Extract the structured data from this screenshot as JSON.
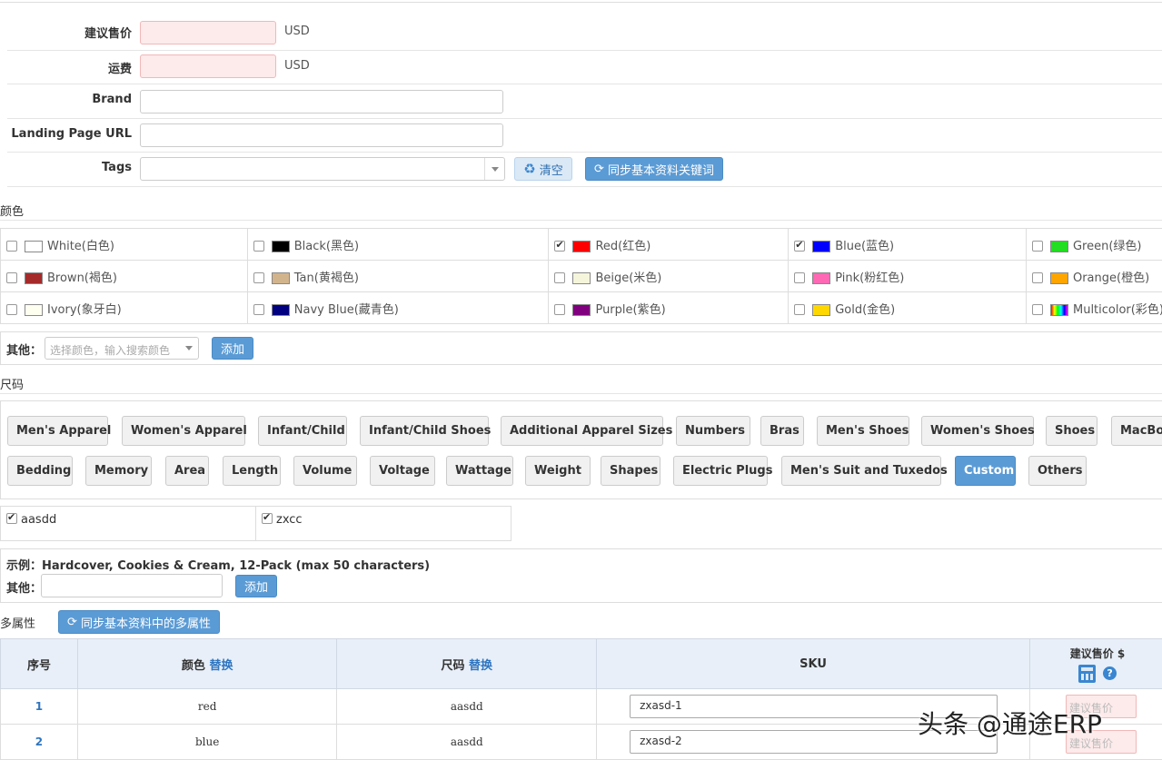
{
  "form": {
    "price_label": "建议售价",
    "price_unit": "USD",
    "shipping_label": "运费",
    "shipping_unit": "USD",
    "brand_label": "Brand",
    "landing_label": "Landing Page URL",
    "tags_label": "Tags",
    "clear_button": "清空",
    "sync_keywords_button": "同步基本资料关键词"
  },
  "colors": {
    "title": "颜色",
    "rows": [
      [
        {
          "label": "White(白色)",
          "hex": "#ffffff",
          "checked": false
        },
        {
          "label": "Black(黑色)",
          "hex": "#000000",
          "checked": false
        },
        {
          "label": "Red(红色)",
          "hex": "#ff0000",
          "checked": true
        },
        {
          "label": "Blue(蓝色)",
          "hex": "#0000ff",
          "checked": true
        },
        {
          "label": "Green(绿色)",
          "hex": "#22dd22",
          "checked": false
        }
      ],
      [
        {
          "label": "Brown(褐色)",
          "hex": "#a52a2a",
          "checked": false
        },
        {
          "label": "Tan(黄褐色)",
          "hex": "#d2b48c",
          "checked": false
        },
        {
          "label": "Beige(米色)",
          "hex": "#f5f5dc",
          "checked": false
        },
        {
          "label": "Pink(粉红色)",
          "hex": "#ff69b4",
          "checked": false
        },
        {
          "label": "Orange(橙色)",
          "hex": "#ffa500",
          "checked": false
        }
      ],
      [
        {
          "label": "Ivory(象牙白)",
          "hex": "#fffff0",
          "checked": false
        },
        {
          "label": "Navy Blue(藏青色)",
          "hex": "#000080",
          "checked": false
        },
        {
          "label": "Purple(紫色)",
          "hex": "#800080",
          "checked": false
        },
        {
          "label": "Gold(金色)",
          "hex": "#ffd700",
          "checked": false
        },
        {
          "label": "Multicolor(彩色)",
          "hex": "rainbow",
          "checked": false
        }
      ]
    ],
    "other_label": "其他：",
    "other_placeholder": "选择颜色，输入搜索颜色",
    "add_button": "添加"
  },
  "sizes": {
    "title": "尺码",
    "row1": [
      "Men's Apparel",
      "Women's Apparel",
      "Infant/Child",
      "Infant/Child Shoes",
      "Additional Apparel Sizes",
      "Numbers",
      "Bras",
      "Men's Shoes",
      "Women's Shoes",
      "Shoes",
      "MacBo"
    ],
    "row2": [
      "Bedding",
      "Memory",
      "Area",
      "Length",
      "Volume",
      "Voltage",
      "Wattage",
      "Weight",
      "Shapes",
      "Electric Plugs",
      "Men's Suit and Tuxedos",
      "Custom",
      "Others"
    ],
    "active": "Custom",
    "custom_items": [
      {
        "label": "aasdd",
        "checked": true
      },
      {
        "label": "zxcc",
        "checked": true
      }
    ],
    "example_text": "示例：Hardcover, Cookies & Cream, 12-Pack (max 50 characters)",
    "other_label": "其他：",
    "add_button": "添加"
  },
  "multi": {
    "title": "多属性",
    "sync_button": "同步基本资料中的多属性",
    "headers": {
      "index": "序号",
      "color": "颜色",
      "size": "尺码",
      "replace": "替换",
      "sku": "SKU",
      "price": "建议售价 $"
    },
    "price_placeholder": "建议售价",
    "rows": [
      {
        "index": "1",
        "color": "red",
        "size": "aasdd",
        "sku": "zxasd-1"
      },
      {
        "index": "2",
        "color": "blue",
        "size": "aasdd",
        "sku": "zxasd-2"
      }
    ]
  },
  "watermark": "头条 @通途ERP"
}
